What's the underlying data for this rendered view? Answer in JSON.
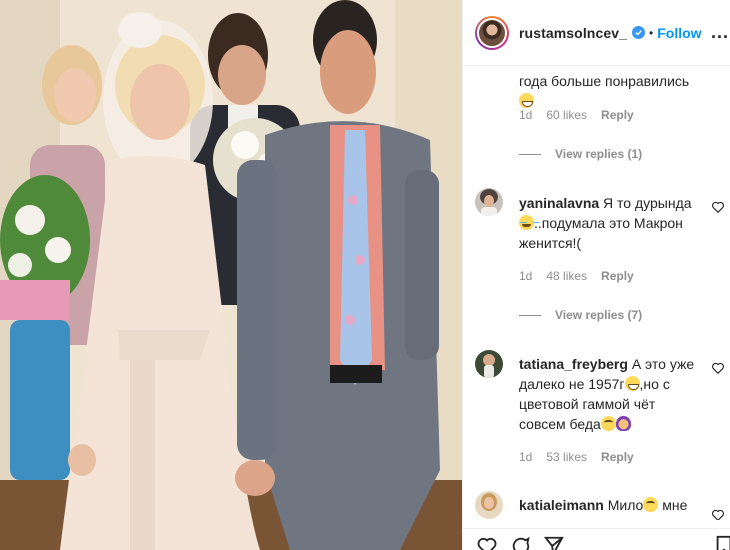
{
  "post": {
    "username": "rustamsolncev_",
    "follow_label": "Follow",
    "separator": "•",
    "more_label": "..."
  },
  "comments": [
    {
      "continued_text": "года больше понравились",
      "emoji": "grin",
      "age": "1d",
      "likes": "60 likes",
      "reply_label": "Reply",
      "view_replies": "View replies (1)"
    },
    {
      "user": "yaninalavna",
      "text_a": "Я то дурында",
      "emoji": "tear",
      "text_b": "..подумала это Макрон женится!(",
      "age": "1d",
      "likes": "48 likes",
      "reply_label": "Reply",
      "view_replies": "View replies (7)"
    },
    {
      "user": "tatiana_freyberg",
      "text_a": "А это уже далеко не 1957г",
      "emoji": "grin",
      "text_b": ",но с цветовой гаммой чёт совсем беда",
      "emoji2": "roll",
      "emoji3": "woman",
      "age": "1d",
      "likes": "53 likes",
      "reply_label": "Reply"
    },
    {
      "user": "katialeimann",
      "text_a": "Мило",
      "emoji": "roll",
      "text_b": "мне"
    }
  ],
  "icons": {
    "verified": "verified-badge-icon",
    "heart": "heart-icon",
    "comment": "comment-icon",
    "share": "share-icon",
    "save": "bookmark-icon"
  },
  "colors": {
    "accent_blue": "#0095f6",
    "muted": "#8e8e8e"
  }
}
